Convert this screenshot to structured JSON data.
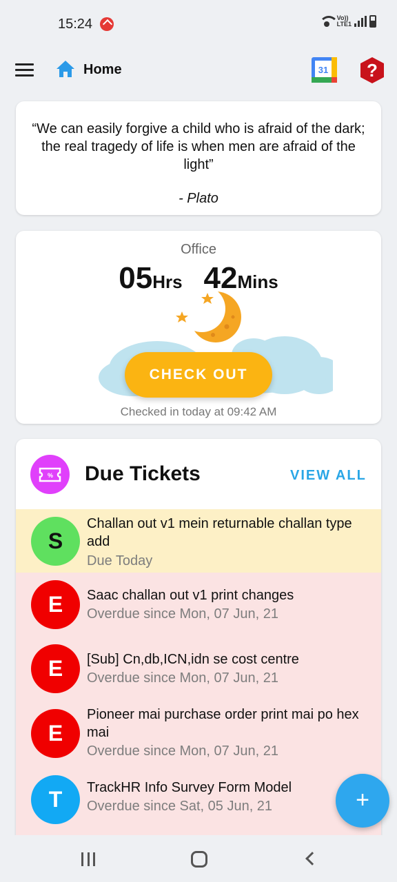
{
  "status_bar": {
    "time": "15:24",
    "network_label_top": "Vo))",
    "network_label_bottom": "LTE1"
  },
  "app_bar": {
    "title": "Home",
    "calendar_day": "31",
    "help_glyph": "?"
  },
  "quote": {
    "text": "“We can easily forgive a child who is afraid of the dark; the real tragedy of life is when men are afraid of the light”",
    "author": "- Plato"
  },
  "office": {
    "label": "Office",
    "hours": "05",
    "hours_unit": "Hrs",
    "minutes": "42",
    "minutes_unit": "Mins",
    "button_label": "CHECK OUT",
    "checked_in_text": "Checked in today at 09:42 AM"
  },
  "tickets": {
    "title": "Due Tickets",
    "view_all_label": "VIEW ALL",
    "items": [
      {
        "initial": "S",
        "title": "Challan out v1 mein returnable challan type add",
        "subtitle": "Due Today",
        "avatar_color": "#5fe05f",
        "status": "due"
      },
      {
        "initial": "E",
        "title": "Saac challan out v1 print changes",
        "subtitle": "Overdue since Mon, 07 Jun, 21",
        "avatar_color": "#f00000",
        "status": "overdue"
      },
      {
        "initial": "E",
        "title": "[Sub] Cn,db,ICN,idn se cost centre",
        "subtitle": "Overdue since Mon, 07 Jun, 21",
        "avatar_color": "#f00000",
        "status": "overdue"
      },
      {
        "initial": "E",
        "title": "Pioneer mai purchase order print mai po hex mai",
        "subtitle": "Overdue since Mon, 07 Jun, 21",
        "avatar_color": "#f00000",
        "status": "overdue"
      },
      {
        "initial": "T",
        "title": "TrackHR Info Survey Form Model",
        "subtitle": "Overdue since Sat, 05 Jun, 21",
        "avatar_color": "#12a9f4",
        "status": "overdue"
      }
    ]
  },
  "fab": {
    "glyph": "+"
  },
  "colors": {
    "accent": "#29a6e6",
    "checkout": "#fbb412",
    "due_bg": "#fdf0c6",
    "overdue_bg": "#fbe3e3",
    "ticket_badge": "#e040fb"
  },
  "icons": [
    "menu-icon",
    "home-icon",
    "calendar-icon",
    "help-icon",
    "ticket-icon",
    "plus-icon",
    "nav-recents-icon",
    "nav-home-icon",
    "nav-back-icon"
  ]
}
